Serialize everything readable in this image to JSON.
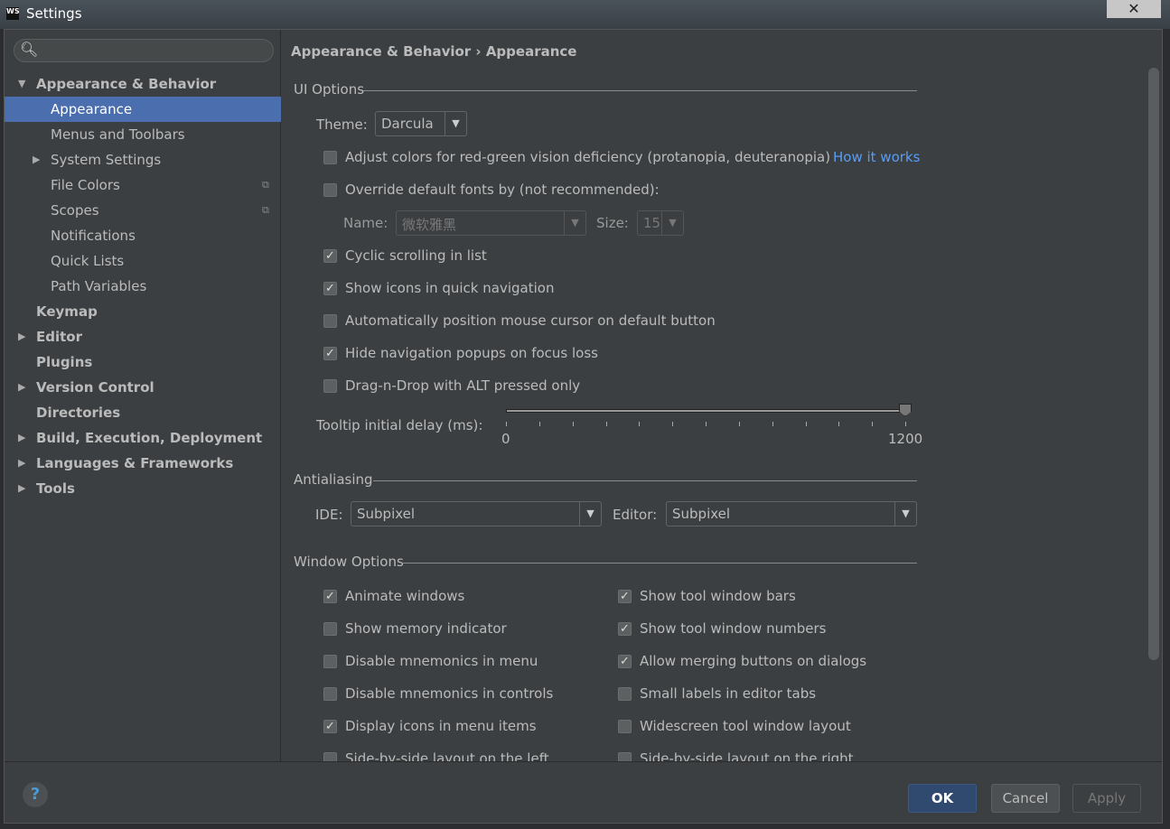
{
  "window": {
    "title": "Settings",
    "app_icon": "WS"
  },
  "sidebar": {
    "search_placeholder": "",
    "items": [
      {
        "label": "Appearance & Behavior",
        "level": 0,
        "bold": true,
        "arrow": "▼"
      },
      {
        "label": "Appearance",
        "level": 1,
        "selected": true
      },
      {
        "label": "Menus and Toolbars",
        "level": 1
      },
      {
        "label": "System Settings",
        "level": 1,
        "arrow": "▶"
      },
      {
        "label": "File Colors",
        "level": 1,
        "copy": true
      },
      {
        "label": "Scopes",
        "level": 1,
        "copy": true
      },
      {
        "label": "Notifications",
        "level": 1
      },
      {
        "label": "Quick Lists",
        "level": 1
      },
      {
        "label": "Path Variables",
        "level": 1
      },
      {
        "label": "Keymap",
        "level": 0,
        "bold": true
      },
      {
        "label": "Editor",
        "level": 0,
        "bold": true,
        "arrow": "▶"
      },
      {
        "label": "Plugins",
        "level": 0,
        "bold": true
      },
      {
        "label": "Version Control",
        "level": 0,
        "bold": true,
        "arrow": "▶"
      },
      {
        "label": "Directories",
        "level": 0,
        "bold": true
      },
      {
        "label": "Build, Execution, Deployment",
        "level": 0,
        "bold": true,
        "arrow": "▶"
      },
      {
        "label": "Languages & Frameworks",
        "level": 0,
        "bold": true,
        "arrow": "▶"
      },
      {
        "label": "Tools",
        "level": 0,
        "bold": true,
        "arrow": "▶"
      }
    ]
  },
  "main": {
    "breadcrumb": "Appearance & Behavior › Appearance",
    "ui_options": {
      "title": "UI Options",
      "theme_label": "Theme:",
      "theme_value": "Darcula",
      "adjust_colors": {
        "label": "Adjust colors for red-green vision deficiency (protanopia, deuteranopia)",
        "checked": false
      },
      "how_it_works": "How it works",
      "override_fonts": {
        "label": "Override default fonts by (not recommended):",
        "checked": false
      },
      "name_label": "Name:",
      "name_value": "微软雅黑",
      "size_label": "Size:",
      "size_value": "15",
      "checkboxes": [
        {
          "label": "Cyclic scrolling in list",
          "checked": true
        },
        {
          "label": "Show icons in quick navigation",
          "checked": true
        },
        {
          "label": "Automatically position mouse cursor on default button",
          "checked": false
        },
        {
          "label": "Hide navigation popups on focus loss",
          "checked": true
        },
        {
          "label": "Drag-n-Drop with ALT pressed only",
          "checked": false
        }
      ],
      "tooltip_label": "Tooltip initial delay (ms):",
      "slider_min": "0",
      "slider_max": "1200",
      "slider_value": 1200
    },
    "antialiasing": {
      "title": "Antialiasing",
      "ide_label": "IDE:",
      "ide_value": "Subpixel",
      "editor_label": "Editor:",
      "editor_value": "Subpixel"
    },
    "window_options": {
      "title": "Window Options",
      "left": [
        {
          "label": "Animate windows",
          "checked": true
        },
        {
          "label": "Show memory indicator",
          "checked": false
        },
        {
          "label": "Disable mnemonics in menu",
          "checked": false
        },
        {
          "label": "Disable mnemonics in controls",
          "checked": false
        },
        {
          "label": "Display icons in menu items",
          "checked": true
        },
        {
          "label": "Side-by-side layout on the left",
          "checked": false
        }
      ],
      "right": [
        {
          "label": "Show tool window bars",
          "checked": true
        },
        {
          "label": "Show tool window numbers",
          "checked": true
        },
        {
          "label": "Allow merging buttons on dialogs",
          "checked": true
        },
        {
          "label": "Small labels in editor tabs",
          "checked": false
        },
        {
          "label": "Widescreen tool window layout",
          "checked": false
        },
        {
          "label": "Side-by-side layout on the right",
          "checked": false
        }
      ]
    }
  },
  "footer": {
    "help": "?",
    "ok": "OK",
    "cancel": "Cancel",
    "apply": "Apply"
  },
  "colors": {
    "selection": "#4b6eaf",
    "link": "#589df6",
    "background": "#3c3f41"
  }
}
